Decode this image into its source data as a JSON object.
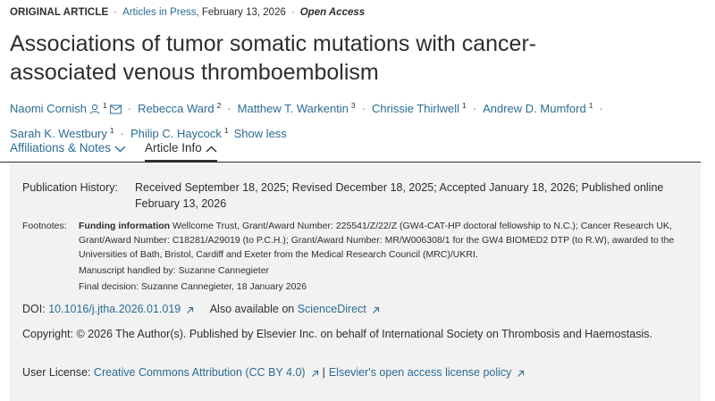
{
  "header": {
    "article_type": "ORIGINAL ARTICLE",
    "section": "Articles in Press",
    "date": "February 13, 2026",
    "access": "Open Access",
    "separator": "·"
  },
  "title": "Associations of tumor somatic mutations with cancer-associated venous thromboembolism",
  "authors": [
    {
      "name": "Naomi Cornish",
      "sup": "1",
      "icons": [
        "person-icon",
        "mail-icon"
      ]
    },
    {
      "name": "Rebecca Ward",
      "sup": "2"
    },
    {
      "name": "Matthew T. Warkentin",
      "sup": "3"
    },
    {
      "name": "Chrissie Thirlwell",
      "sup": "1"
    },
    {
      "name": "Andrew D. Mumford",
      "sup": "1"
    },
    {
      "name": "Sarah K. Westbury",
      "sup": "1"
    },
    {
      "name": "Philip C. Haycock",
      "sup": "1"
    }
  ],
  "show_less": "Show less",
  "tabs": {
    "affiliations": "Affiliations & Notes",
    "article_info": "Article Info",
    "active": "article_info"
  },
  "info": {
    "publication_history_label": "Publication History:",
    "publication_history": "Received September 18, 2025; Revised December 18, 2025; Accepted January 18, 2026; Published online February 13, 2026",
    "footnotes_label": "Footnotes:",
    "funding_heading": "Funding information",
    "funding_text": "Wellcome Trust, Grant/Award Number: 225541/Z/22/Z (GW4-CAT-HP doctoral fellowship to N.C.); Cancer Research UK, Grant/Award Number: C18281/A29019 (to P.C.H.); Grant/Award Number: MR/W006308/1 for the GW4 BIOMED2 DTP (to R.W), awarded to the Universities of Bath, Bristol, Cardiff and Exeter from the Medical Research Council (MRC)/UKRI.",
    "handled_by": "Manuscript handled by: Suzanne Cannegieter",
    "final_decision": "Final decision: Suzanne Cannegieter, 18 January 2026",
    "doi_label": "DOI:",
    "doi": "10.1016/j.jtha.2026.01.019",
    "also_available_label": "Also available on",
    "also_available_link": "ScienceDirect",
    "copyright": "Copyright: © 2026 The Author(s). Published by Elsevier Inc. on behalf of International Society on Thrombosis and Haemostasis.",
    "user_license_label": "User License:",
    "license_link": "Creative Commons Attribution (CC BY 4.0)",
    "license_separator": "|",
    "policy_link": "Elsevier's open access license policy"
  },
  "colors": {
    "link": "#2b6c93",
    "text": "#2e2e2e",
    "panel_bg": "#f2f2f2"
  }
}
